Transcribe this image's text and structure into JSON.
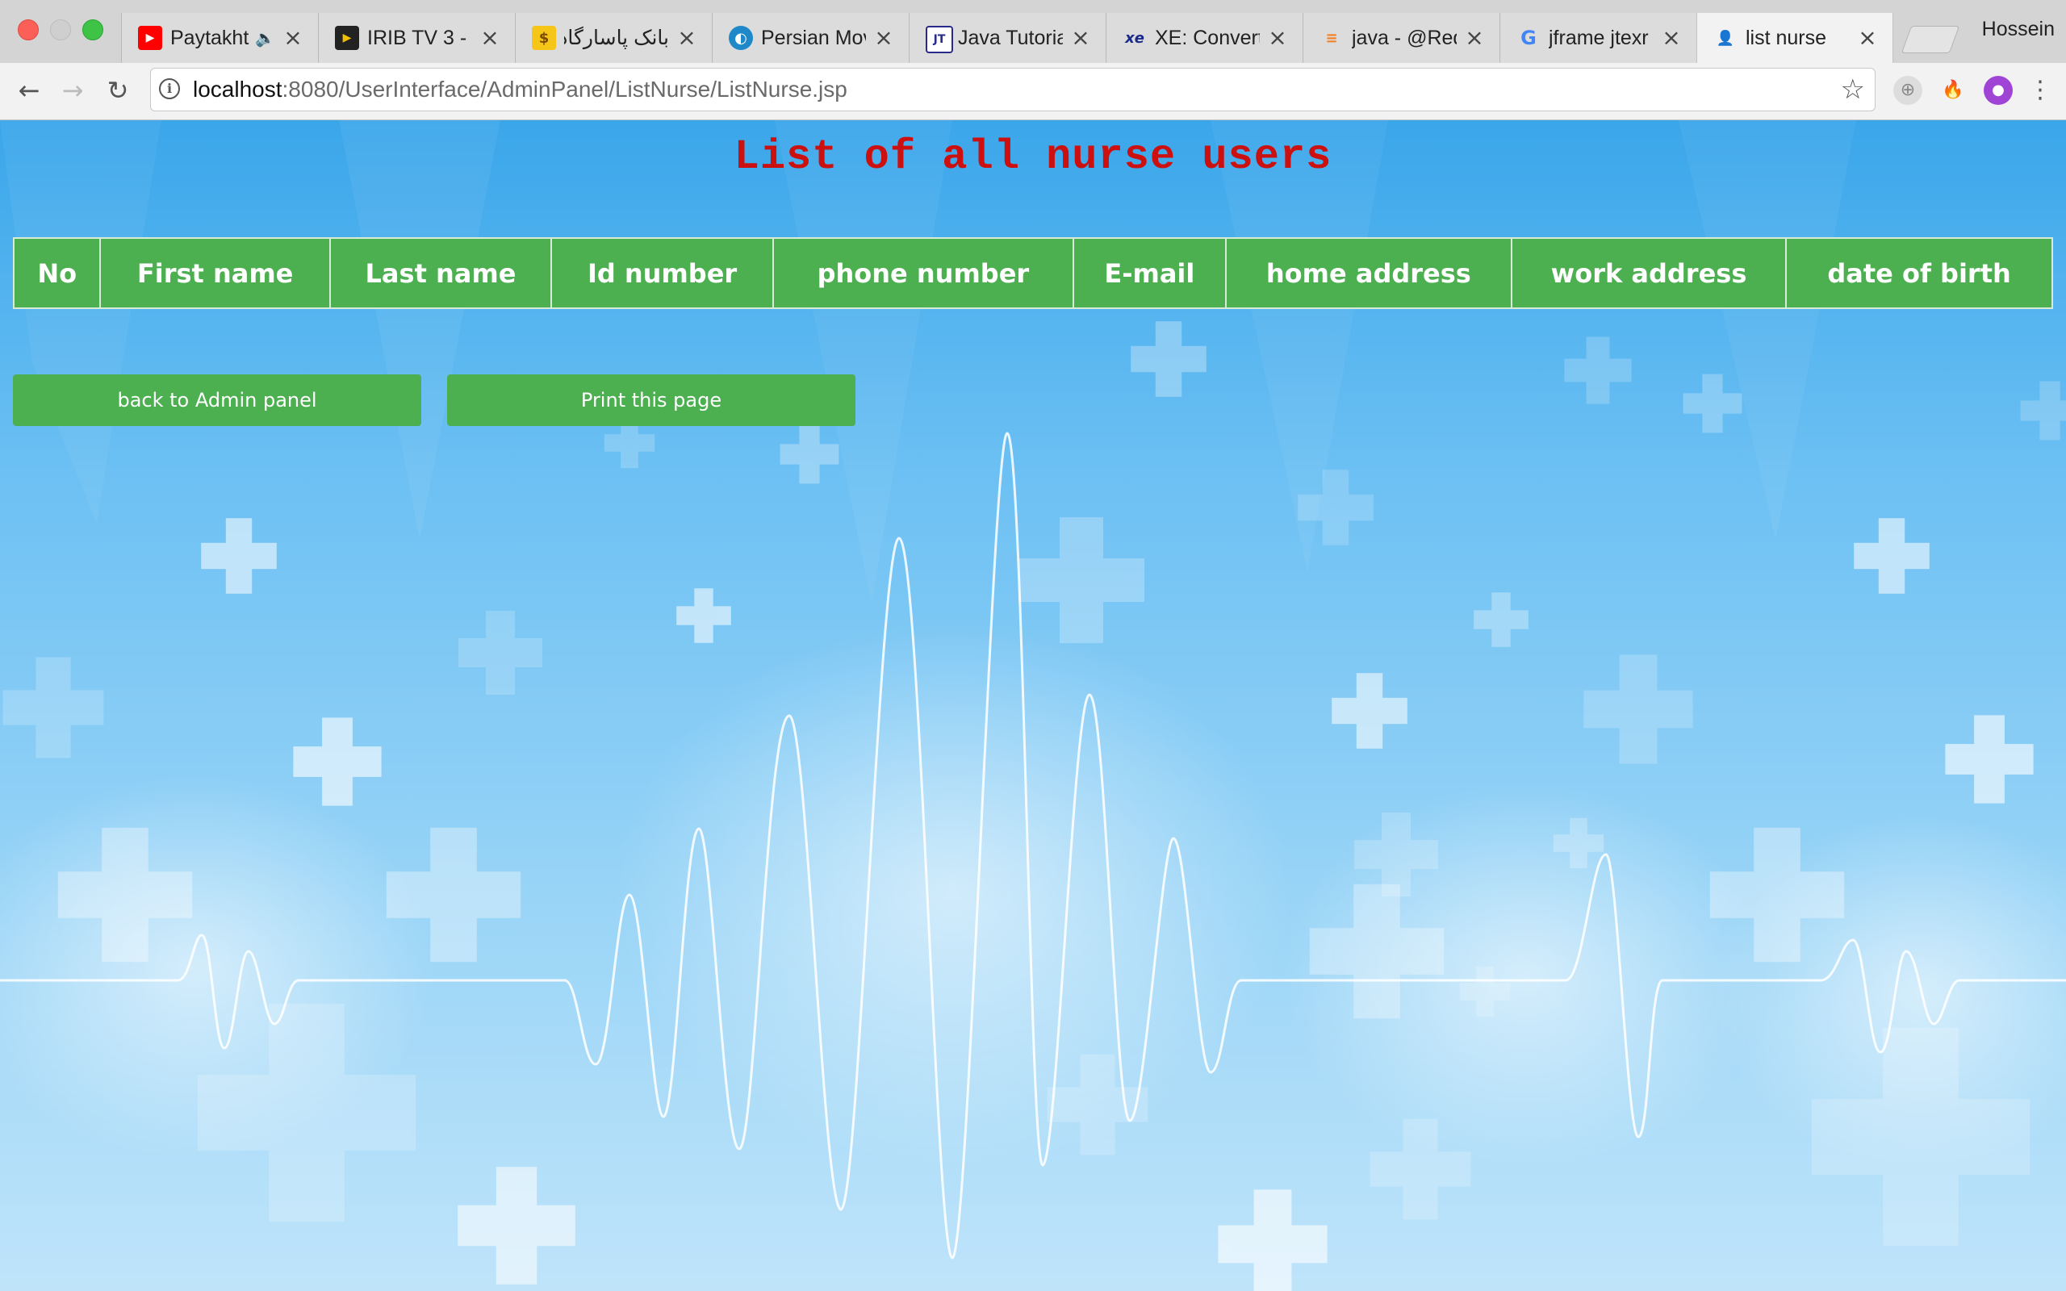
{
  "browser": {
    "profile_name": "Hossein",
    "tabs": [
      {
        "title": "Paytakht",
        "icon": "youtube-icon",
        "audio": true
      },
      {
        "title": "IRIB TV 3 - ",
        "icon": "play-icon"
      },
      {
        "title": "بانک پاسارگاد :: ",
        "icon": "bank-icon",
        "rtl": true
      },
      {
        "title": "Persian Mov",
        "icon": "globe-icon"
      },
      {
        "title": "Java Tutoria",
        "icon": "java-tutorial-icon"
      },
      {
        "title": "XE: Convert",
        "icon": "xe-icon"
      },
      {
        "title": "java - @Req",
        "icon": "stackoverflow-icon"
      },
      {
        "title": "jframe jtexr",
        "icon": "google-icon"
      },
      {
        "title": "list nurse",
        "icon": "nurse-icon",
        "active": true
      }
    ],
    "url": {
      "host": "localhost",
      "path": ":8080/UserInterface/AdminPanel/ListNurse/ListNurse.jsp"
    }
  },
  "page": {
    "heading": "List of all nurse users",
    "table": {
      "columns": [
        "No",
        "First name",
        "Last name",
        "Id number",
        "phone number",
        "E-mail",
        "home address",
        "work address",
        "date of birth"
      ],
      "rows": []
    },
    "buttons": {
      "back": "back to Admin panel",
      "print": "Print this page"
    }
  },
  "colors": {
    "heading": "#cc1010",
    "table_header_bg": "#4caf50",
    "button_bg": "#4caf50",
    "page_bg": "#6cc0f3"
  }
}
